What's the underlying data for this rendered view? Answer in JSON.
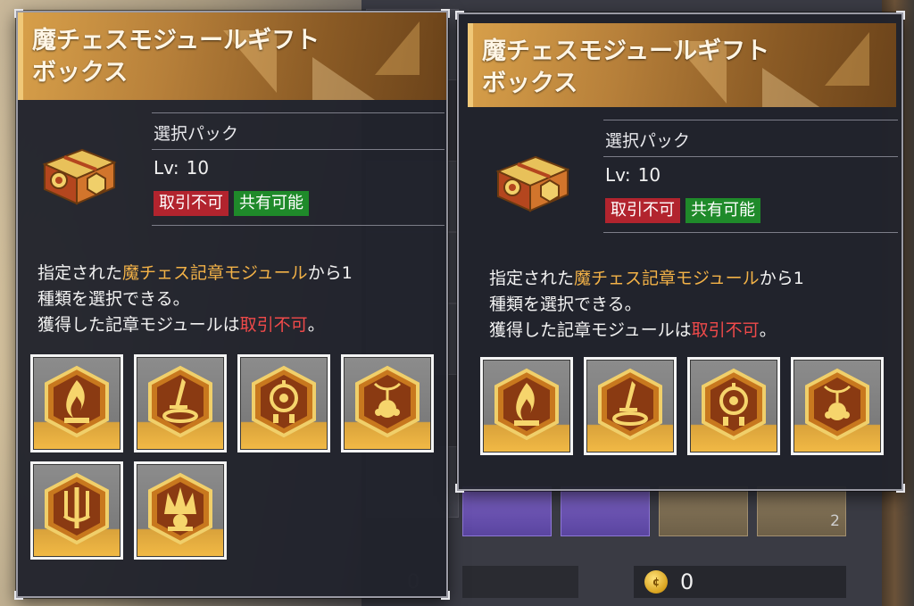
{
  "background": {
    "coin_value": "0",
    "left_faded_count": "0",
    "grid_counts": [
      "2"
    ]
  },
  "tooltips": [
    {
      "title": "魔チェスモジュールギフト\nボックス",
      "item_type": "選択パック",
      "level_label": "Lv:",
      "level_value": "10",
      "badge_trade": "取引不可",
      "badge_share": "共有可能",
      "desc_1a": "指定された",
      "desc_1b": "魔チェス記章モジュール",
      "desc_1c": "から1",
      "desc_2": "種類を選択できる。",
      "desc_3a": "獲得した記章モジュールは",
      "desc_3b": "取引不可",
      "desc_3c": "。",
      "modules": [
        "module-flame",
        "module-sword",
        "module-wheel",
        "module-sun",
        "module-trident",
        "module-crown"
      ]
    },
    {
      "title": "魔チェスモジュールギフト\nボックス",
      "item_type": "選択パック",
      "level_label": "Lv:",
      "level_value": "10",
      "badge_trade": "取引不可",
      "badge_share": "共有可能",
      "desc_1a": "指定された",
      "desc_1b": "魔チェス記章モジュール",
      "desc_1c": "から1",
      "desc_2": "種類を選択できる。",
      "desc_3a": "獲得した記章モジュールは",
      "desc_3b": "取引不可",
      "desc_3c": "。",
      "modules": [
        "module-flame",
        "module-sword",
        "module-wheel",
        "module-sun"
      ]
    }
  ],
  "colors": {
    "accent_gold": "#f3b247",
    "warning_red": "#f04a4a",
    "badge_red": "#b2242e",
    "badge_green": "#1f8a2a"
  }
}
